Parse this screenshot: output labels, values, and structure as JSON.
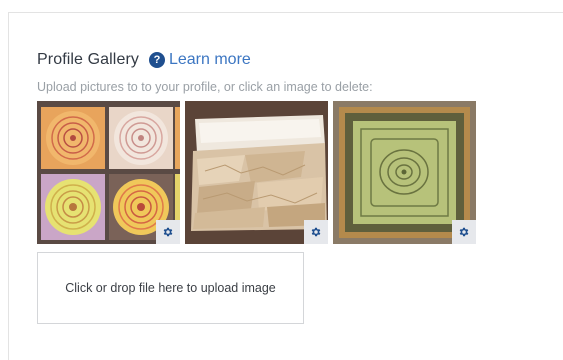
{
  "gallery": {
    "title": "Profile Gallery",
    "help_icon_glyph": "?",
    "learn_more_label": "Learn more",
    "subtitle": "Upload pictures to to your profile, or click an image to delete:",
    "images": [
      {
        "name": "profile-image-1",
        "action_icon": "gear-icon"
      },
      {
        "name": "profile-image-2",
        "action_icon": "gear-icon"
      },
      {
        "name": "profile-image-3",
        "action_icon": "gear-icon"
      }
    ],
    "upload_label": "Click or drop file here to upload image"
  },
  "colors": {
    "accent": "#3c76c2",
    "help_icon": "#1f4f8f",
    "title": "#333a44",
    "muted": "#9aa0a6",
    "gear_bg": "#e6e8ec"
  }
}
